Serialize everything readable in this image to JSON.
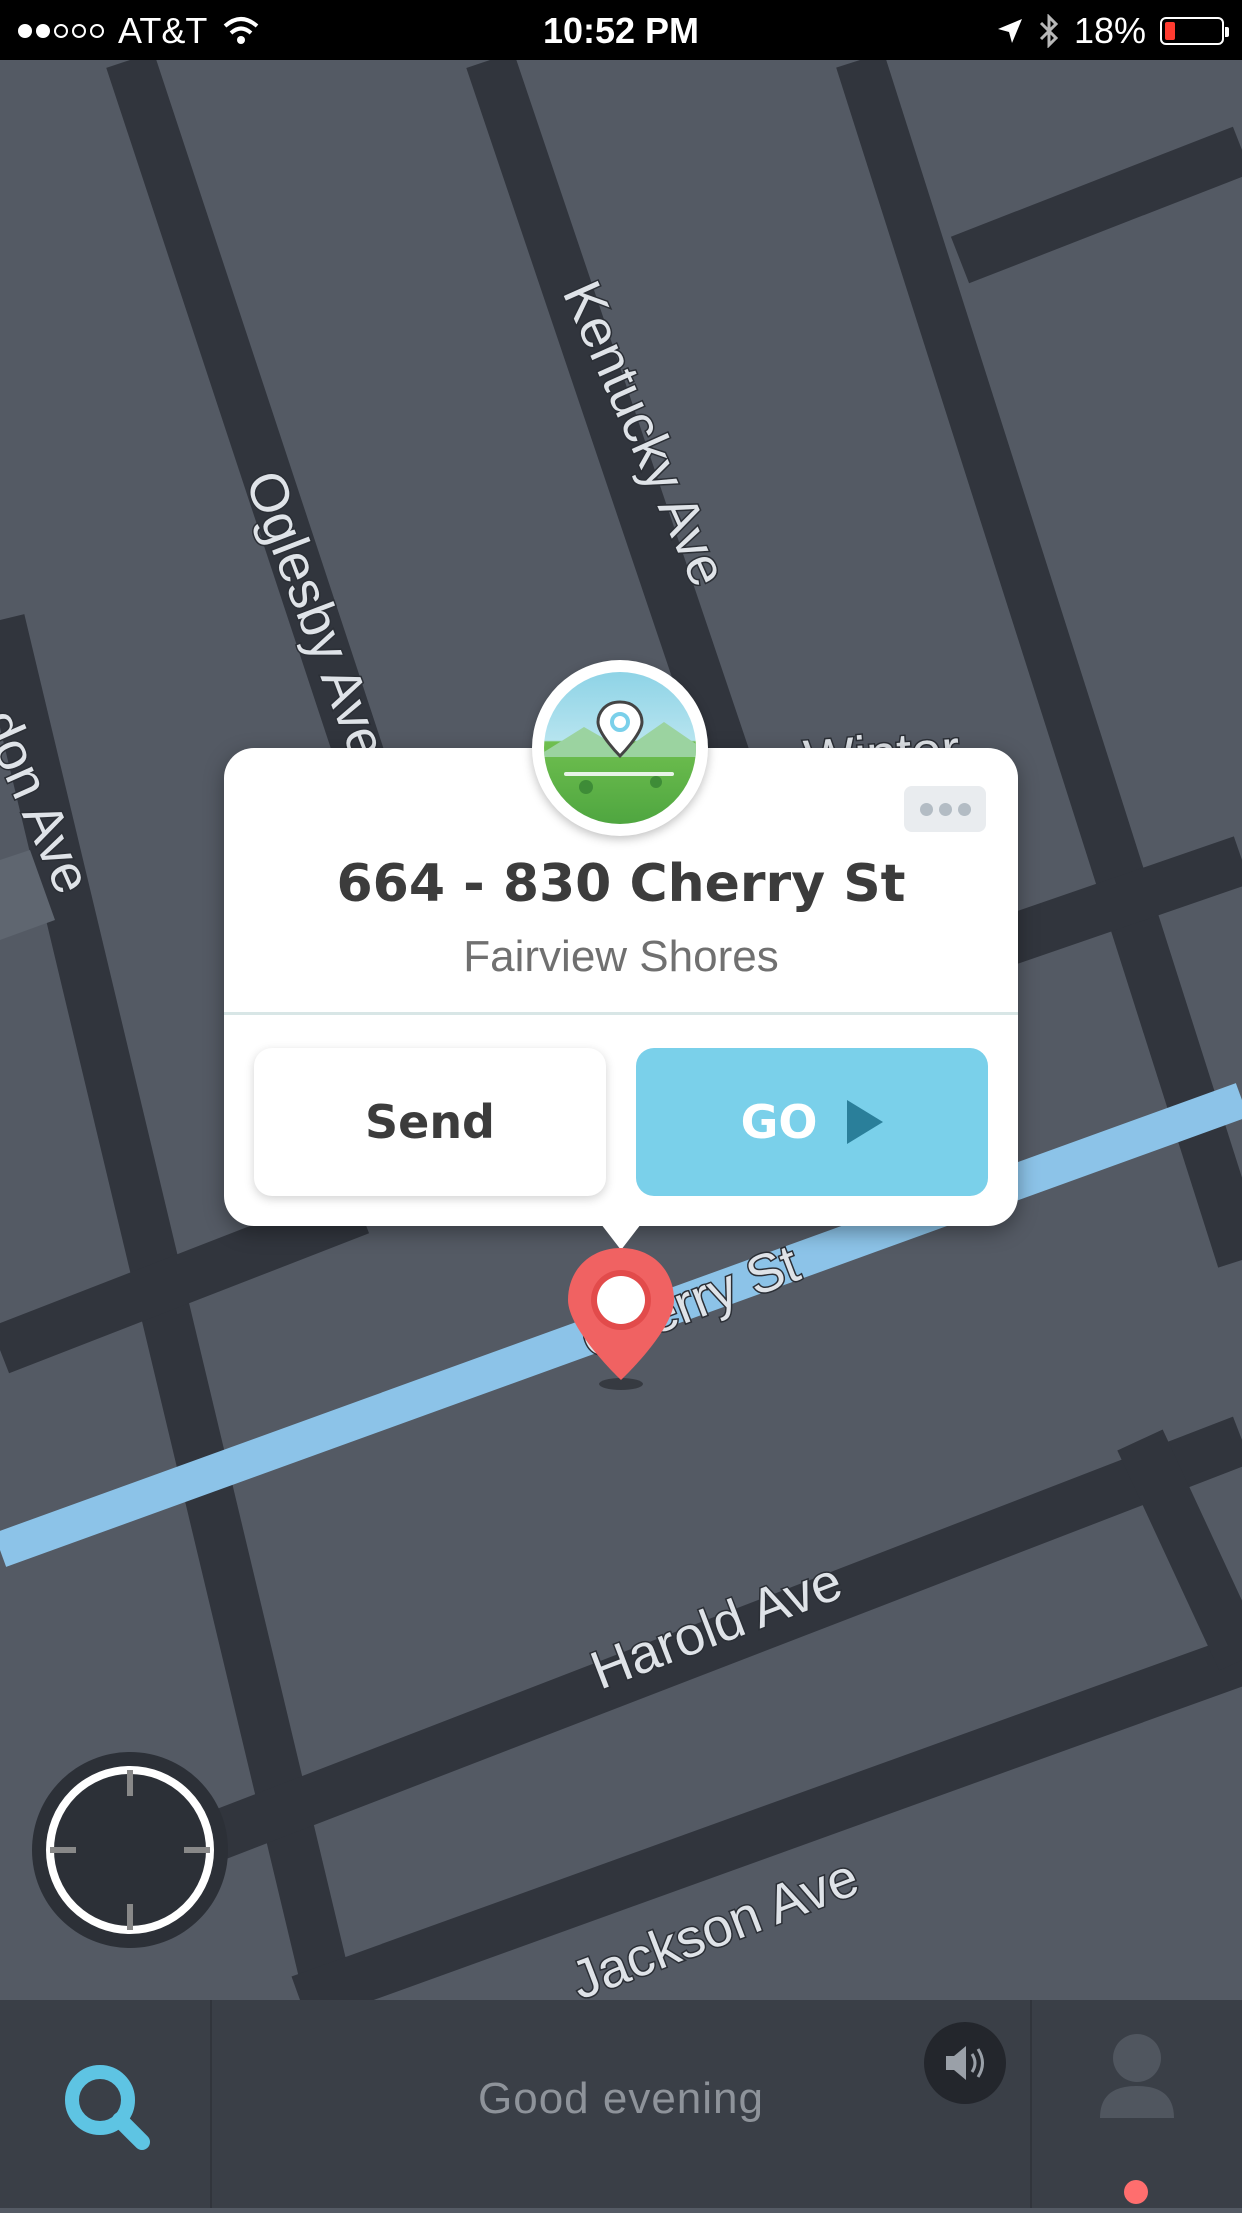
{
  "status_bar": {
    "carrier": "AT&T",
    "time": "10:52 PM",
    "battery_percent": "18%",
    "battery_level": 0.18,
    "icons": [
      "signal-dots-icon",
      "wifi-icon",
      "location-arrow-icon",
      "bluetooth-icon",
      "battery-icon"
    ]
  },
  "map": {
    "streets": [
      "Oglesby Ave",
      "Kentucky Ave",
      "don Ave",
      "Winter",
      "Cherry St",
      "Harold Ave",
      "Jackson Ave"
    ]
  },
  "place_card": {
    "title": "664 - 830 Cherry St",
    "subtitle": "Fairview Shores",
    "send_label": "Send",
    "go_label": "GO"
  },
  "bottom_bar": {
    "greeting": "Good evening"
  },
  "colors": {
    "accent": "#7ad0ea",
    "route": "#8cc3e8",
    "pin": "#f06262",
    "map_bg": "#545a64"
  }
}
